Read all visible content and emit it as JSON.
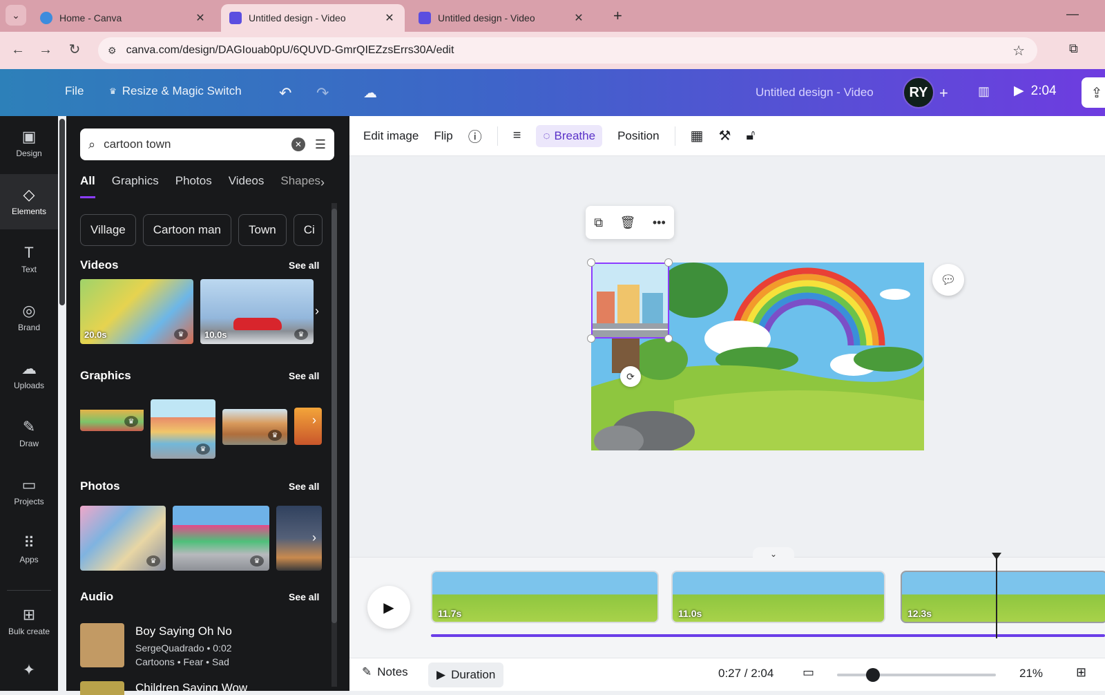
{
  "browser": {
    "tabs": [
      {
        "title": "Home - Canva",
        "active": false
      },
      {
        "title": "Untitled design - Video",
        "active": true
      },
      {
        "title": "Untitled design - Video",
        "active": false
      }
    ],
    "url": "canva.com/design/DAGIouab0pU/6QUVD-GmrQIEZzsErrs30A/edit"
  },
  "header": {
    "file_label": "File",
    "resize_label": "Resize & Magic Switch",
    "doc_title": "Untitled design - Video",
    "avatar_initials": "RY",
    "play_time": "2:04"
  },
  "rail": [
    {
      "label": "Design",
      "icon": "design-icon",
      "active": false
    },
    {
      "label": "Elements",
      "icon": "elements-icon",
      "active": true
    },
    {
      "label": "Text",
      "icon": "text-icon",
      "active": false
    },
    {
      "label": "Brand",
      "icon": "brand-icon",
      "active": false
    },
    {
      "label": "Uploads",
      "icon": "uploads-icon",
      "active": false
    },
    {
      "label": "Draw",
      "icon": "draw-icon",
      "active": false
    },
    {
      "label": "Projects",
      "icon": "projects-icon",
      "active": false
    },
    {
      "label": "Apps",
      "icon": "apps-icon",
      "active": false
    },
    {
      "label": "Bulk create",
      "icon": "bulk-create-icon",
      "active": false
    }
  ],
  "panel": {
    "search_value": "cartoon town",
    "filters": [
      "All",
      "Graphics",
      "Photos",
      "Videos",
      "Shapes"
    ],
    "chips": [
      "Village",
      "Cartoon man",
      "Town",
      "Ci"
    ],
    "sections": {
      "videos": {
        "title": "Videos",
        "see_all": "See all",
        "durations": [
          "20.0s",
          "10.0s"
        ]
      },
      "graphics": {
        "title": "Graphics",
        "see_all": "See all"
      },
      "photos": {
        "title": "Photos",
        "see_all": "See all"
      },
      "audio": {
        "title": "Audio",
        "see_all": "See all"
      }
    },
    "audio_items": [
      {
        "title": "Boy Saying Oh No",
        "meta": "SergeQuadrado • 0:02",
        "tags": "Cartoons • Fear • Sad"
      },
      {
        "title": "Children Saying Wow"
      }
    ]
  },
  "context_toolbar": {
    "edit_image": "Edit image",
    "flip": "Flip",
    "breathe": "Breathe",
    "position": "Position"
  },
  "timeline": {
    "clips": [
      {
        "length": "11.7s"
      },
      {
        "length": "11.0s"
      },
      {
        "length": "12.3s"
      }
    ]
  },
  "bottom_bar": {
    "notes": "Notes",
    "duration": "Duration",
    "time": "0:27 / 2:04",
    "zoom": "21%",
    "zoom_level": 0.2
  },
  "colors": {
    "accent": "#8b3dff",
    "header_start": "#2d80b9",
    "header_end": "#6e3ce0",
    "panel_bg": "#18191b"
  }
}
